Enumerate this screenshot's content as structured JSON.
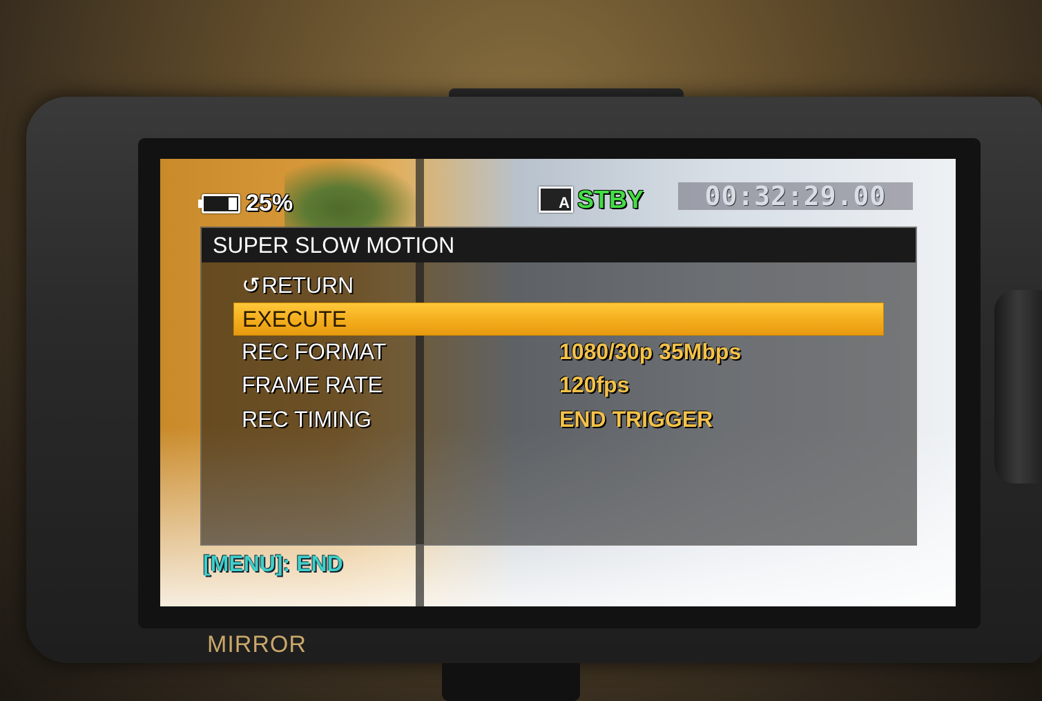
{
  "status": {
    "battery_percent": "25%",
    "battery_level": 0.25,
    "card_icon_letter": "A",
    "mode": "STBY",
    "timecode": "00:32:29.00"
  },
  "menu": {
    "title": "SUPER SLOW MOTION",
    "return_label": "RETURN",
    "items": [
      {
        "label": "EXECUTE",
        "value": "",
        "selected": true
      },
      {
        "label": "REC FORMAT",
        "value": "1080/30p 35Mbps"
      },
      {
        "label": "FRAME RATE",
        "value": "120fps"
      },
      {
        "label": "REC TIMING",
        "value": "END TRIGGER"
      }
    ]
  },
  "footer": {
    "hint": "[MENU]: END"
  },
  "bezel": {
    "label": "MIRROR"
  },
  "colors": {
    "selection": "#f3ad1c",
    "value_text": "#f4c24a",
    "stby_text": "#44dd44",
    "hint_text": "#3fd0c8"
  },
  "icons": {
    "battery": "battery-icon",
    "card": "memory-card-icon",
    "return": "return-arrow-icon"
  }
}
